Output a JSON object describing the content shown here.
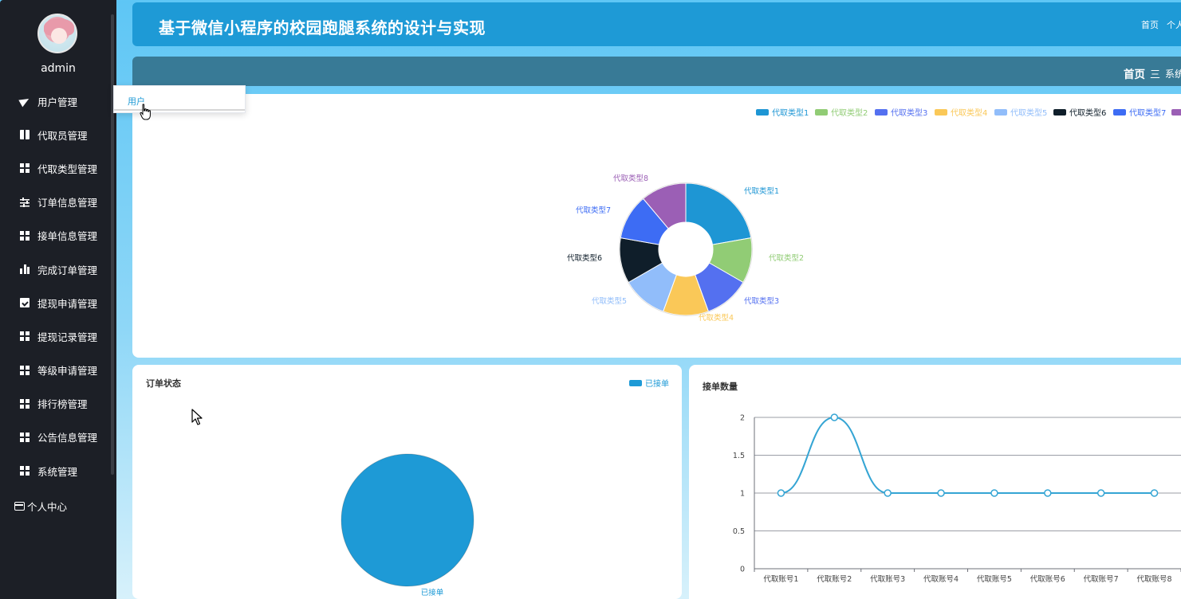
{
  "app": {
    "title": "基于微信小程序的校园跑腿系统的设计与实现",
    "header_nav": [
      "首页",
      "个人"
    ]
  },
  "breadcrumb": {
    "home": "首页",
    "separator": "三",
    "current": "系统"
  },
  "sidebar": {
    "username": "admin",
    "items": [
      {
        "label": "用户管理",
        "icon": "paper-plane-icon"
      },
      {
        "label": "代取员管理",
        "icon": "book-icon"
      },
      {
        "label": "代取类型管理",
        "icon": "grid-icon"
      },
      {
        "label": "订单信息管理",
        "icon": "sliders-icon"
      },
      {
        "label": "接单信息管理",
        "icon": "grid-icon"
      },
      {
        "label": "完成订单管理",
        "icon": "bar-chart-icon"
      },
      {
        "label": "提现申请管理",
        "icon": "clipboard-check-icon"
      },
      {
        "label": "提现记录管理",
        "icon": "grid-icon"
      },
      {
        "label": "等级申请管理",
        "icon": "grid-icon"
      },
      {
        "label": "排行榜管理",
        "icon": "grid-icon"
      },
      {
        "label": "公告信息管理",
        "icon": "grid-icon"
      },
      {
        "label": "系统管理",
        "icon": "grid-icon"
      }
    ],
    "personal_center": "个人中心"
  },
  "dropdown": {
    "items": [
      "用户"
    ]
  },
  "colors": {
    "header": "#1e9ad6",
    "subbar": "#387a96",
    "sidebar": "#1c1f26",
    "accent": "#1e9ad6"
  },
  "chart_data": [
    {
      "type": "pie",
      "variant": "donut",
      "title": "",
      "legend_position": "top-right",
      "categories": [
        "代取类型1",
        "代取类型2",
        "代取类型3",
        "代取类型4",
        "代取类型5",
        "代取类型6",
        "代取类型7",
        "代取类型8"
      ],
      "values": [
        2,
        1,
        1,
        1,
        1,
        1,
        1,
        1
      ],
      "colors": [
        "#1e96d4",
        "#91cc75",
        "#5470f0",
        "#fac858",
        "#91bdfa",
        "#0f1e2a",
        "#3d6cf4",
        "#9b5fb5"
      ]
    },
    {
      "type": "pie",
      "title": "订单状态",
      "legend_position": "top-right",
      "categories": [
        "已接单"
      ],
      "values": [
        1
      ],
      "colors": [
        "#1e9ad6"
      ]
    },
    {
      "type": "line",
      "title": "接单数量",
      "smooth": true,
      "grid": true,
      "categories": [
        "代取账号1",
        "代取账号2",
        "代取账号3",
        "代取账号4",
        "代取账号5",
        "代取账号6",
        "代取账号7",
        "代取账号8"
      ],
      "values": [
        1,
        2,
        1,
        1,
        1,
        1,
        1,
        1
      ],
      "ylim": [
        0,
        2
      ],
      "yticks": [
        "0",
        "0.5",
        "1",
        "1.5",
        "2"
      ],
      "color": "#35a5d4"
    }
  ]
}
